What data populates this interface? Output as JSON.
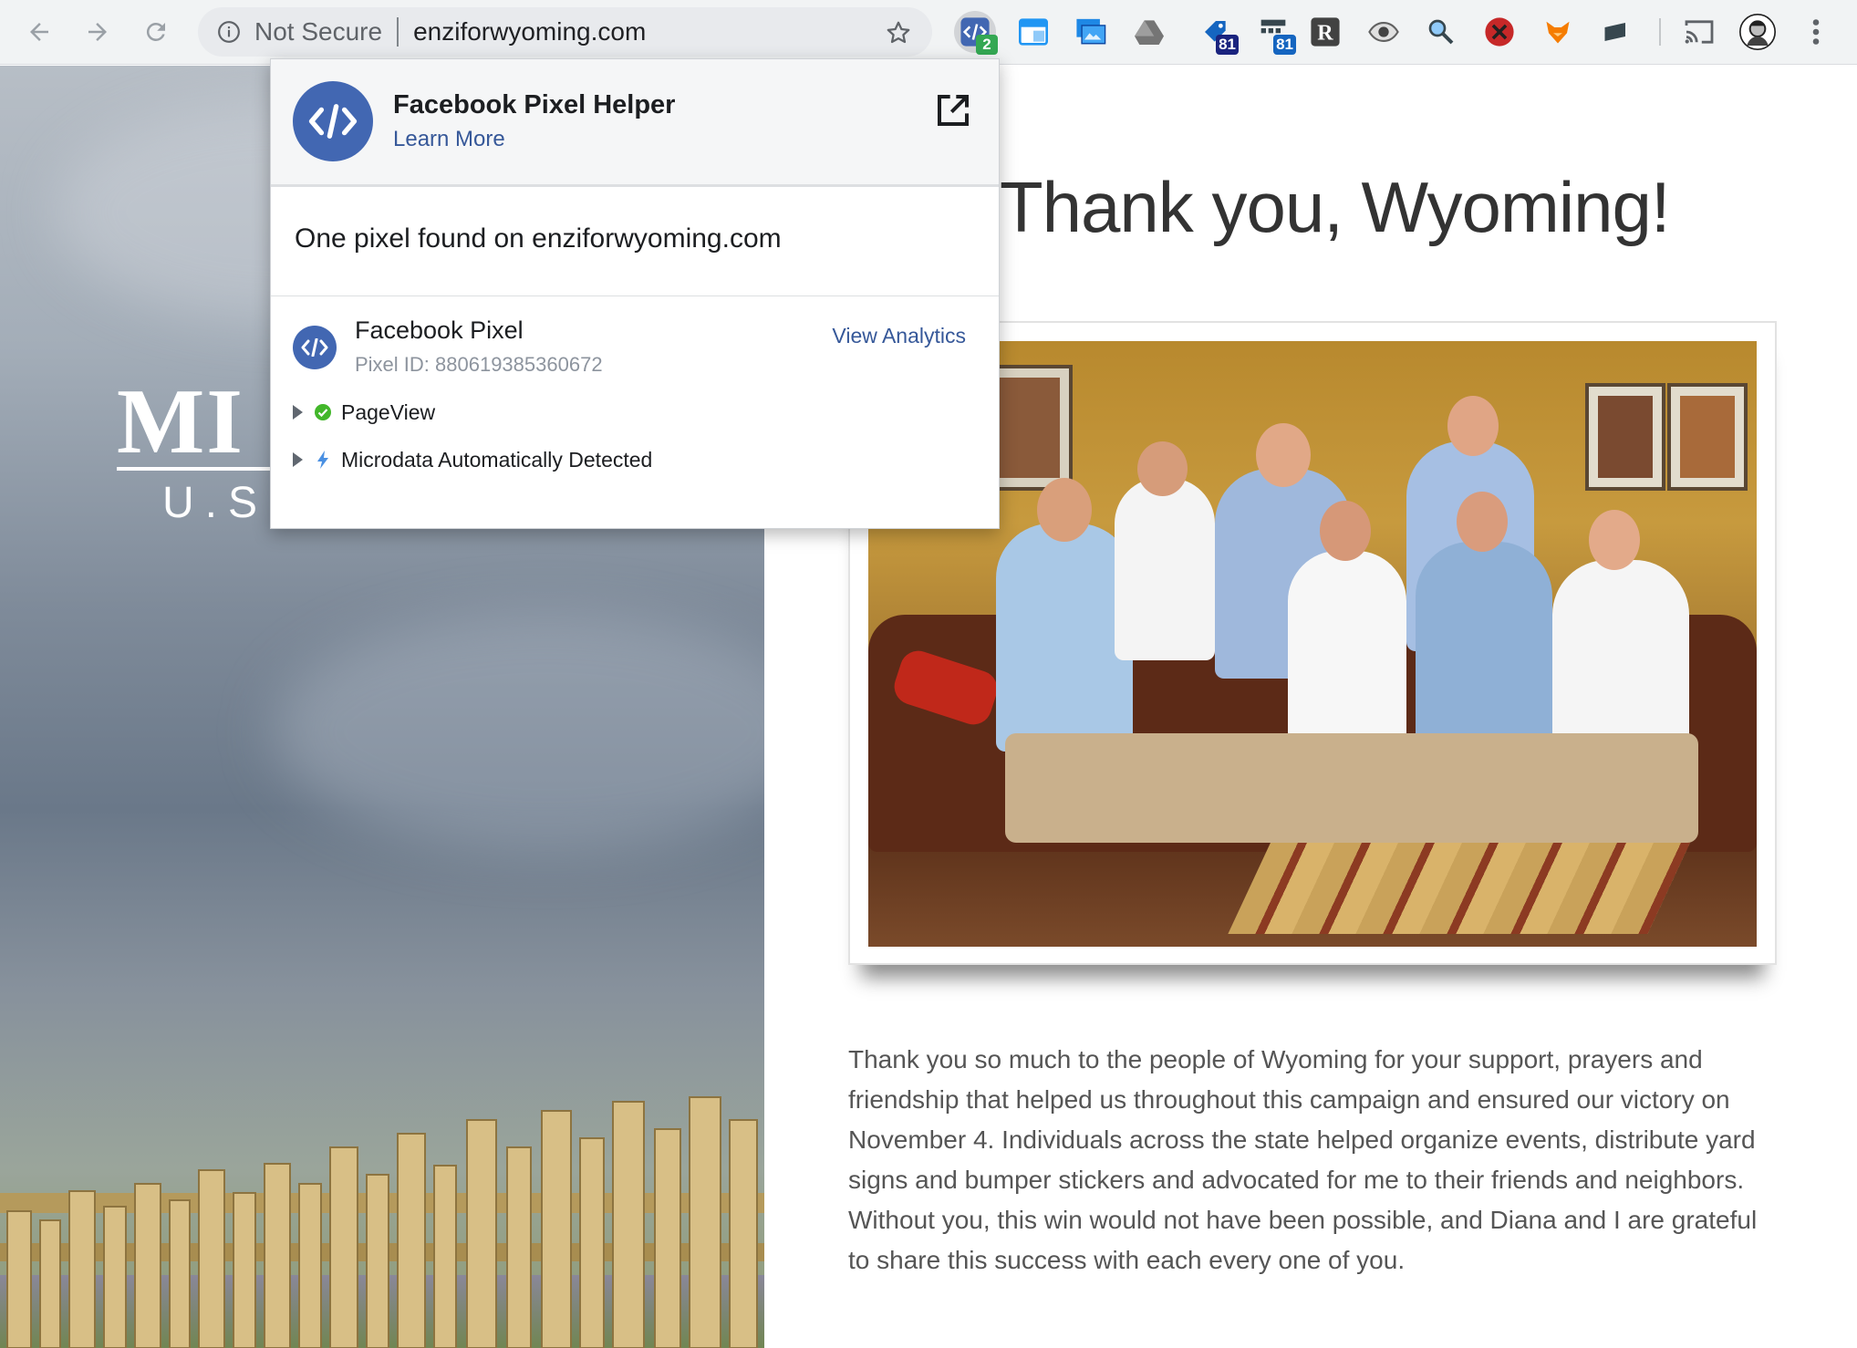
{
  "browser": {
    "security_label": "Not Secure",
    "url": "enziforwyoming.com",
    "extensions": [
      {
        "name": "facebook-pixel-helper",
        "badge": "2",
        "badge_color": "#34a853"
      },
      {
        "name": "window-ext",
        "badge": ""
      },
      {
        "name": "screenshot-ext",
        "badge": ""
      },
      {
        "name": "drive-ext",
        "badge": ""
      },
      {
        "name": "tag-ext",
        "badge": "81",
        "badge_color": "#1a237e"
      },
      {
        "name": "structure-ext",
        "badge": "81",
        "badge_color": "#1565c0"
      },
      {
        "name": "r-ext",
        "badge": ""
      },
      {
        "name": "eye-ext",
        "badge": ""
      },
      {
        "name": "magnifier-ext",
        "badge": ""
      },
      {
        "name": "block-ext",
        "badge": ""
      },
      {
        "name": "fox-ext",
        "badge": ""
      },
      {
        "name": "box-ext",
        "badge": ""
      }
    ]
  },
  "popup": {
    "title": "Facebook Pixel Helper",
    "learn_more": "Learn More",
    "found_text": "One pixel found on enziforwyoming.com",
    "pixel": {
      "name": "Facebook Pixel",
      "id_text": "Pixel ID: 880619385360672",
      "view_analytics": "View Analytics"
    },
    "events": [
      {
        "label": "PageView",
        "status": "success"
      },
      {
        "label": "Microdata Automatically Detected",
        "status": "info"
      }
    ]
  },
  "page": {
    "logo_big": "MI",
    "logo_sub": "U.S",
    "headline": "Thank you, Wyoming!",
    "body": "Thank you so much to the people of Wyoming for your support, prayers and friendship that helped us throughout this campaign and ensured our victory on November 4. Individuals across the state helped organize events, distribute yard signs and bumper stickers and advocated for me to their friends and neighbors. Without you, this win would not have been possible, and Diana and I are grateful to share this success with each every one of you."
  },
  "colors": {
    "facebook_blue": "#4267b2",
    "link_blue": "#365899",
    "success_green": "#42b72a",
    "info_blue": "#4a90e2"
  }
}
